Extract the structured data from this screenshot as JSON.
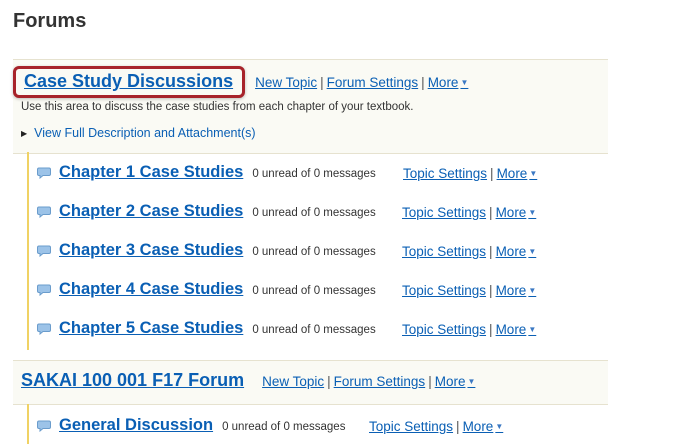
{
  "page": {
    "title": "Forums"
  },
  "forums": [
    {
      "title": "Case Study Discussions",
      "new_topic": "New Topic",
      "settings": "Forum Settings",
      "more": "More",
      "description": "Use this area to discuss the case studies from each chapter of your textbook.",
      "full_description_link": "View Full Description and Attachment(s)",
      "topics": [
        {
          "title": "Chapter 1 Case Studies",
          "status": "0 unread of 0 messages",
          "settings": "Topic Settings",
          "more": "More"
        },
        {
          "title": "Chapter 2 Case Studies",
          "status": "0 unread of 0 messages",
          "settings": "Topic Settings",
          "more": "More"
        },
        {
          "title": "Chapter 3 Case Studies",
          "status": "0 unread of 0 messages",
          "settings": "Topic Settings",
          "more": "More"
        },
        {
          "title": "Chapter 4 Case Studies",
          "status": "0 unread of 0 messages",
          "settings": "Topic Settings",
          "more": "More"
        },
        {
          "title": "Chapter 5 Case Studies",
          "status": "0 unread of 0 messages",
          "settings": "Topic Settings",
          "more": "More"
        }
      ]
    },
    {
      "title": "SAKAI 100 001 F17 Forum",
      "new_topic": "New Topic",
      "settings": "Forum Settings",
      "more": "More",
      "topics": [
        {
          "title": "General Discussion",
          "status": "0 unread of 0 messages",
          "settings": "Topic Settings",
          "more": "More"
        }
      ]
    }
  ],
  "colors": {
    "link": "#0a5fb4",
    "highlight_border": "#a7232a",
    "forum_background": "#fafaf4",
    "topic_rule": "#f0d264"
  },
  "icons": {
    "topic": "speech-bubble-icon",
    "dropdown": "caret-down-icon",
    "expand": "triangle-right-icon"
  }
}
